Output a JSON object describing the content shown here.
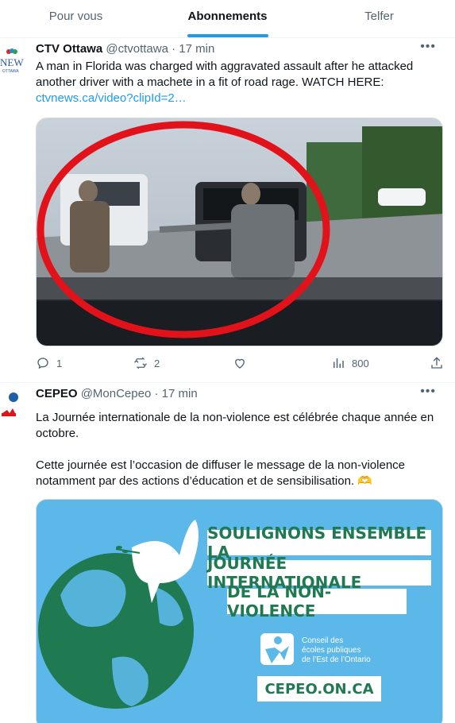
{
  "tabs": [
    {
      "label": "Pour vous"
    },
    {
      "label": "Abonnements"
    },
    {
      "label": "Telfer"
    }
  ],
  "tweet1": {
    "name": "CTV Ottawa",
    "handle": "@ctvottawa",
    "dot": "·",
    "time": "17 min",
    "more": "•••",
    "line1": "A man in Florida was charged with aggravated assault after he attacked",
    "line2": "another driver with a machete in a fit of road rage. WATCH HERE:",
    "link": "ctvnews.ca/video?clipId=2…",
    "avatar_text": "NEWS",
    "avatar_sub": "OTTAWA",
    "replies": "1",
    "retweets": "2",
    "views": "800"
  },
  "tweet2": {
    "name": "CEPEO",
    "handle": "@MonCepeo",
    "dot": "·",
    "time": "17 min",
    "more": "•••",
    "line1": "La Journée internationale de la non-violence est célébrée chaque année en",
    "line2": "octobre.",
    "line3": "Cette journée est l’occasion de diffuser le message de la non-violence",
    "line4": "notamment par des actions d’éducation et de sensibilisation.",
    "emoji": "🫶",
    "banner_line1": "SOULIGNONS ENSEMBLE LA",
    "banner_line2": "JOURNÉE INTERNATIONALE",
    "banner_line3": "DE LA NON-VIOLENCE",
    "org1": "Conseil des",
    "org2": "écoles publiques",
    "org3": "de l’Est de l’Ontario",
    "site": "CEPEO.ON.CA"
  },
  "colors": {
    "accent": "#1d9bf0",
    "banner_bg": "#5bb8e8",
    "banner_green": "#1f7a52"
  },
  "icons": [
    "reply-icon",
    "retweet-icon",
    "like-icon",
    "views-icon",
    "share-icon",
    "more-icon",
    "peace-dove-icon",
    "globe-icon"
  ]
}
